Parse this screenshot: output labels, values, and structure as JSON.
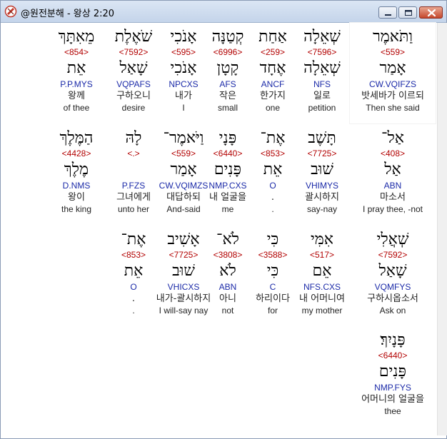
{
  "window": {
    "title": "@원전분해 - 왕상 2:20",
    "icon": "bible-app-icon"
  },
  "rows": [
    [
      {
        "heb": "וַתֹּאמֶר",
        "strong": "<559>",
        "root": "אָמַר",
        "parse": "CW.VQIFZS",
        "ko": "밧세바가 이르되",
        "en": "Then she said"
      },
      {
        "heb": "שְׁאֵלָה",
        "strong": "<7596>",
        "root": "שְׁאֵלָה",
        "parse": "NFS",
        "ko": "일로",
        "en": "petition"
      },
      {
        "heb": "אַחַת",
        "strong": "<259>",
        "root": "אֶחָד",
        "parse": "ANCF",
        "ko": "한가지",
        "en": "one"
      },
      {
        "heb": "קְטַנָּה",
        "strong": "<6996>",
        "root": "קָטָן",
        "parse": "AFS",
        "ko": "작은",
        "en": "small"
      },
      {
        "heb": "אָנֹכִי",
        "strong": "<595>",
        "root": "אָנֹכִי",
        "parse": "NPCXS",
        "ko": "내가",
        "en": "I"
      },
      {
        "heb": "שֹׁאֶלֶת",
        "strong": "<7592>",
        "root": "שָׁאַל",
        "parse": "VQPAFS",
        "ko": "구하오니",
        "en": "desire"
      },
      {
        "heb": "מֵאִתָּךְ",
        "strong": "<854>",
        "root": "אֵת",
        "parse": "P.P.MYS",
        "ko": "왕께",
        "en": "of thee"
      }
    ],
    [
      {
        "heb": "אַל־",
        "strong": "<408>",
        "root": "אַל",
        "parse": "ABN",
        "ko": "마소서",
        "en": "I pray thee, -not"
      },
      {
        "heb": "תָּשֶׁב",
        "strong": "<7725>",
        "root": "שׁוּב",
        "parse": "VHIMYS",
        "ko": "괄시하지",
        "en": "say-nay"
      },
      {
        "heb": "אֶת־",
        "strong": "<853>",
        "root": "אֵת",
        "parse": "O",
        "ko": ".",
        "en": "."
      },
      {
        "heb": "פָּנָי",
        "strong": "<6440>",
        "root": "פָּנִים",
        "parse": "NMP.CXS",
        "ko": "내 얼굴을",
        "en": "me"
      },
      {
        "heb": "וַיֹּאמֶר־",
        "strong": "<559>",
        "root": "אָמַר",
        "parse": "CW.VQIMZS",
        "ko": "대답하되",
        "en": "And-said"
      },
      {
        "heb": "לָהּ",
        "strong": "<.>",
        "root": "",
        "parse": "P.FZS",
        "ko": "그녀에게",
        "en": "unto her"
      },
      {
        "heb": "הַמֶּלֶךְ",
        "strong": "<4428>",
        "root": "מֶלֶךְ",
        "parse": "D.NMS",
        "ko": "왕이",
        "en": "the king"
      }
    ],
    [
      {
        "heb": "שְׁאֲלִי",
        "strong": "<7592>",
        "root": "שָׁאַל",
        "parse": "VQMFYS",
        "ko": "구하시옵소서",
        "en": "Ask on"
      },
      {
        "heb": "אִמִּי",
        "strong": "<517>",
        "root": "אֵם",
        "parse": "NFS.CXS",
        "ko": "내 어머니여",
        "en": "my mother"
      },
      {
        "heb": "כִּי",
        "strong": "<3588>",
        "root": "כִּי",
        "parse": "C",
        "ko": "하리이다",
        "en": "for"
      },
      {
        "heb": "לֹא־",
        "strong": "<3808>",
        "root": "לֹא",
        "parse": "ABN",
        "ko": "아니",
        "en": "not"
      },
      {
        "heb": "אָשִׁיב",
        "strong": "<7725>",
        "root": "שׁוּב",
        "parse": "VHICXS",
        "ko": "내가-괄시하지",
        "en": "I will-say nay"
      },
      {
        "heb": "אֶת־",
        "strong": "<853>",
        "root": "אֵת",
        "parse": "O",
        "ko": ".",
        "en": "."
      }
    ],
    [
      {
        "heb": "פָּנָיִךְ׃",
        "strong": "<6440>",
        "root": "פָּנִים",
        "parse": "NMP.FYS",
        "ko": "어머니의 얼굴을",
        "en": "thee"
      }
    ]
  ]
}
